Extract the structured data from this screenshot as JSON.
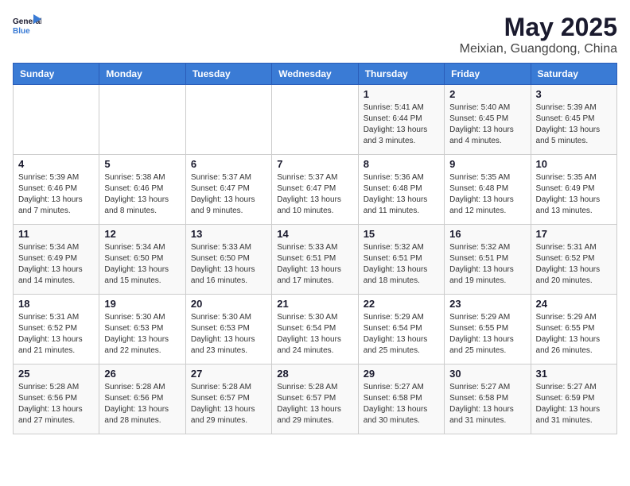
{
  "logo": {
    "line1": "General",
    "line2": "Blue"
  },
  "title": "May 2025",
  "subtitle": "Meixian, Guangdong, China",
  "days_of_week": [
    "Sunday",
    "Monday",
    "Tuesday",
    "Wednesday",
    "Thursday",
    "Friday",
    "Saturday"
  ],
  "weeks": [
    [
      {
        "day": "",
        "sunrise": "",
        "sunset": "",
        "daylight": ""
      },
      {
        "day": "",
        "sunrise": "",
        "sunset": "",
        "daylight": ""
      },
      {
        "day": "",
        "sunrise": "",
        "sunset": "",
        "daylight": ""
      },
      {
        "day": "",
        "sunrise": "",
        "sunset": "",
        "daylight": ""
      },
      {
        "day": "1",
        "sunrise": "Sunrise: 5:41 AM",
        "sunset": "Sunset: 6:44 PM",
        "daylight": "Daylight: 13 hours and 3 minutes."
      },
      {
        "day": "2",
        "sunrise": "Sunrise: 5:40 AM",
        "sunset": "Sunset: 6:45 PM",
        "daylight": "Daylight: 13 hours and 4 minutes."
      },
      {
        "day": "3",
        "sunrise": "Sunrise: 5:39 AM",
        "sunset": "Sunset: 6:45 PM",
        "daylight": "Daylight: 13 hours and 5 minutes."
      }
    ],
    [
      {
        "day": "4",
        "sunrise": "Sunrise: 5:39 AM",
        "sunset": "Sunset: 6:46 PM",
        "daylight": "Daylight: 13 hours and 7 minutes."
      },
      {
        "day": "5",
        "sunrise": "Sunrise: 5:38 AM",
        "sunset": "Sunset: 6:46 PM",
        "daylight": "Daylight: 13 hours and 8 minutes."
      },
      {
        "day": "6",
        "sunrise": "Sunrise: 5:37 AM",
        "sunset": "Sunset: 6:47 PM",
        "daylight": "Daylight: 13 hours and 9 minutes."
      },
      {
        "day": "7",
        "sunrise": "Sunrise: 5:37 AM",
        "sunset": "Sunset: 6:47 PM",
        "daylight": "Daylight: 13 hours and 10 minutes."
      },
      {
        "day": "8",
        "sunrise": "Sunrise: 5:36 AM",
        "sunset": "Sunset: 6:48 PM",
        "daylight": "Daylight: 13 hours and 11 minutes."
      },
      {
        "day": "9",
        "sunrise": "Sunrise: 5:35 AM",
        "sunset": "Sunset: 6:48 PM",
        "daylight": "Daylight: 13 hours and 12 minutes."
      },
      {
        "day": "10",
        "sunrise": "Sunrise: 5:35 AM",
        "sunset": "Sunset: 6:49 PM",
        "daylight": "Daylight: 13 hours and 13 minutes."
      }
    ],
    [
      {
        "day": "11",
        "sunrise": "Sunrise: 5:34 AM",
        "sunset": "Sunset: 6:49 PM",
        "daylight": "Daylight: 13 hours and 14 minutes."
      },
      {
        "day": "12",
        "sunrise": "Sunrise: 5:34 AM",
        "sunset": "Sunset: 6:50 PM",
        "daylight": "Daylight: 13 hours and 15 minutes."
      },
      {
        "day": "13",
        "sunrise": "Sunrise: 5:33 AM",
        "sunset": "Sunset: 6:50 PM",
        "daylight": "Daylight: 13 hours and 16 minutes."
      },
      {
        "day": "14",
        "sunrise": "Sunrise: 5:33 AM",
        "sunset": "Sunset: 6:51 PM",
        "daylight": "Daylight: 13 hours and 17 minutes."
      },
      {
        "day": "15",
        "sunrise": "Sunrise: 5:32 AM",
        "sunset": "Sunset: 6:51 PM",
        "daylight": "Daylight: 13 hours and 18 minutes."
      },
      {
        "day": "16",
        "sunrise": "Sunrise: 5:32 AM",
        "sunset": "Sunset: 6:51 PM",
        "daylight": "Daylight: 13 hours and 19 minutes."
      },
      {
        "day": "17",
        "sunrise": "Sunrise: 5:31 AM",
        "sunset": "Sunset: 6:52 PM",
        "daylight": "Daylight: 13 hours and 20 minutes."
      }
    ],
    [
      {
        "day": "18",
        "sunrise": "Sunrise: 5:31 AM",
        "sunset": "Sunset: 6:52 PM",
        "daylight": "Daylight: 13 hours and 21 minutes."
      },
      {
        "day": "19",
        "sunrise": "Sunrise: 5:30 AM",
        "sunset": "Sunset: 6:53 PM",
        "daylight": "Daylight: 13 hours and 22 minutes."
      },
      {
        "day": "20",
        "sunrise": "Sunrise: 5:30 AM",
        "sunset": "Sunset: 6:53 PM",
        "daylight": "Daylight: 13 hours and 23 minutes."
      },
      {
        "day": "21",
        "sunrise": "Sunrise: 5:30 AM",
        "sunset": "Sunset: 6:54 PM",
        "daylight": "Daylight: 13 hours and 24 minutes."
      },
      {
        "day": "22",
        "sunrise": "Sunrise: 5:29 AM",
        "sunset": "Sunset: 6:54 PM",
        "daylight": "Daylight: 13 hours and 25 minutes."
      },
      {
        "day": "23",
        "sunrise": "Sunrise: 5:29 AM",
        "sunset": "Sunset: 6:55 PM",
        "daylight": "Daylight: 13 hours and 25 minutes."
      },
      {
        "day": "24",
        "sunrise": "Sunrise: 5:29 AM",
        "sunset": "Sunset: 6:55 PM",
        "daylight": "Daylight: 13 hours and 26 minutes."
      }
    ],
    [
      {
        "day": "25",
        "sunrise": "Sunrise: 5:28 AM",
        "sunset": "Sunset: 6:56 PM",
        "daylight": "Daylight: 13 hours and 27 minutes."
      },
      {
        "day": "26",
        "sunrise": "Sunrise: 5:28 AM",
        "sunset": "Sunset: 6:56 PM",
        "daylight": "Daylight: 13 hours and 28 minutes."
      },
      {
        "day": "27",
        "sunrise": "Sunrise: 5:28 AM",
        "sunset": "Sunset: 6:57 PM",
        "daylight": "Daylight: 13 hours and 29 minutes."
      },
      {
        "day": "28",
        "sunrise": "Sunrise: 5:28 AM",
        "sunset": "Sunset: 6:57 PM",
        "daylight": "Daylight: 13 hours and 29 minutes."
      },
      {
        "day": "29",
        "sunrise": "Sunrise: 5:27 AM",
        "sunset": "Sunset: 6:58 PM",
        "daylight": "Daylight: 13 hours and 30 minutes."
      },
      {
        "day": "30",
        "sunrise": "Sunrise: 5:27 AM",
        "sunset": "Sunset: 6:58 PM",
        "daylight": "Daylight: 13 hours and 31 minutes."
      },
      {
        "day": "31",
        "sunrise": "Sunrise: 5:27 AM",
        "sunset": "Sunset: 6:59 PM",
        "daylight": "Daylight: 13 hours and 31 minutes."
      }
    ]
  ]
}
